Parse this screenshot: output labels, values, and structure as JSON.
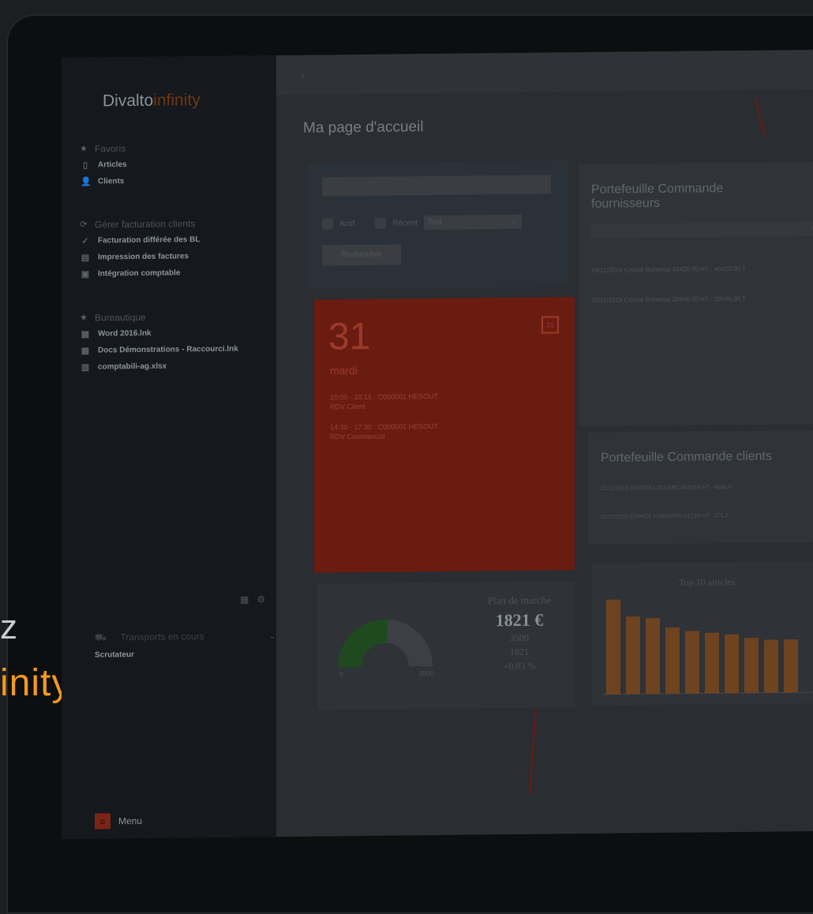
{
  "brand": {
    "name_part1": "Divalto",
    "name_part2": "infinity"
  },
  "left_text": {
    "line1": "z",
    "line2": "inity"
  },
  "sidebar": {
    "groups": [
      {
        "title": "Favoris",
        "items": [
          "Articles",
          "Clients"
        ]
      },
      {
        "title": "Gérer facturation clients",
        "items": [
          "Facturation différée des BL",
          "Impression des factures",
          "Intégration comptable"
        ]
      },
      {
        "title": "Bureautique",
        "items": [
          "Word 2016.lnk",
          "Docs Démonstrations - Raccourci.lnk",
          "comptabili-ag.xlsx"
        ]
      }
    ],
    "transport": "Transports en cours",
    "scrutateur": "Scrutateur",
    "menu_label": "Menu"
  },
  "main": {
    "back": "‹",
    "page_title": "Ma page d'accueil",
    "search": {
      "actif_label": "Actif",
      "recent_label": "Récent",
      "select_value": "Tout",
      "button": "Rechercher"
    },
    "calendar": {
      "day": "31",
      "weekday": "mardi",
      "events": [
        {
          "line1": "10:00 - 10:15 : C000001 HESOUT",
          "line2": "RDV Client"
        },
        {
          "line1": "14:30 - 17:30 : C000001 HESOUT",
          "line2": "RDV Commercial"
        }
      ]
    },
    "gauge": {
      "min": "0",
      "max": "3500",
      "value_fraction": 0.52,
      "plan_title": "Plan de marche",
      "amount": "1821 €",
      "target": "3500",
      "current": "1821",
      "change": "+0,03 %"
    },
    "pf_fournisseurs": {
      "title": "Portefeuille Commande fournisseurs",
      "rows": [
        "19/11/2019 Crystal Bohemia    40420,00 HT -    40420,00 T",
        "26/11/2019 Crystal Bohemia    28546,00 HT -    28546,00 T"
      ]
    },
    "pf_clients": {
      "title": "Portefeuille Commande clients",
      "rows": [
        "21/11/2019 CENTRE LECLERC    4832,06 HT -    4836,0",
        "31/12/2019 ESPACE FORMATIO    312,68 HT -    375,2"
      ]
    },
    "top10": {
      "title": "Top 10 articles"
    }
  },
  "chart_data": {
    "type": "bar",
    "title": "Top 10 articles",
    "values": [
      100,
      82,
      80,
      70,
      66,
      64,
      62,
      58,
      56,
      56
    ],
    "bar_color": "#6d4320"
  }
}
